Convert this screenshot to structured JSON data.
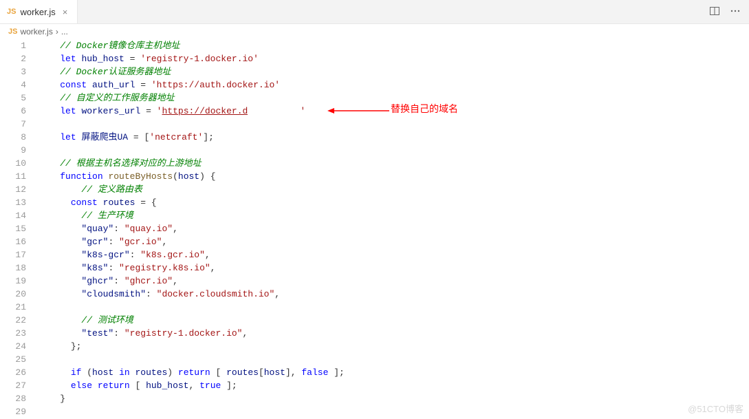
{
  "tab": {
    "icon": "JS",
    "name": "worker.js"
  },
  "breadcrumb": {
    "icon": "JS",
    "file": "worker.js",
    "sep": "›",
    "rest": "..."
  },
  "annotation": "替换自己的域名",
  "watermark": "@51CTO博客",
  "code": {
    "l1": {
      "comment": "// Docker镜像仓库主机地址"
    },
    "l2": {
      "kw": "let",
      "name": "hub_host",
      "eq": " = ",
      "str": "'registry-1.docker.io'"
    },
    "l3": {
      "comment": "// Docker认证服务器地址"
    },
    "l4": {
      "kw": "const",
      "name": "auth_url",
      "eq": " = ",
      "str": "'https://auth.docker.io'"
    },
    "l5": {
      "comment": "// 自定义的工作服务器地址"
    },
    "l6": {
      "kw": "let",
      "name": "workers_url",
      "eq": " = ",
      "q1": "'",
      "url": "https://docker.d",
      "q2": "'"
    },
    "l8": {
      "kw": "let",
      "name": "屏蔽爬虫UA",
      "eq": " = [",
      "str": "'netcraft'",
      "end": "];"
    },
    "l10": {
      "comment": "// 根据主机名选择对应的上游地址"
    },
    "l11": {
      "kw": "function",
      "fn": "routeByHosts",
      "args": "host"
    },
    "l12": {
      "comment": "// 定义路由表"
    },
    "l13": {
      "kw": "const",
      "name": "routes",
      "eq": " = {"
    },
    "l14": {
      "comment": "// 生产环境"
    },
    "l15": {
      "k": "\"quay\"",
      "v": "\"quay.io\""
    },
    "l16": {
      "k": "\"gcr\"",
      "v": "\"gcr.io\""
    },
    "l17": {
      "k": "\"k8s-gcr\"",
      "v": "\"k8s.gcr.io\""
    },
    "l18": {
      "k": "\"k8s\"",
      "v": "\"registry.k8s.io\""
    },
    "l19": {
      "k": "\"ghcr\"",
      "v": "\"ghcr.io\""
    },
    "l20": {
      "k": "\"cloudsmith\"",
      "v": "\"docker.cloudsmith.io\""
    },
    "l22": {
      "comment": "// 测试环境"
    },
    "l23": {
      "k": "\"test\"",
      "v": "\"registry-1.docker.io\""
    },
    "l24": {
      "t": "};"
    },
    "l26": {
      "kw1": "if",
      "cond_a": "host",
      "cond_in": "in",
      "cond_b": "routes",
      "kw2": "return",
      "a1": "routes",
      "a2": "host",
      "kw3": "false"
    },
    "l27": {
      "kw1": "else",
      "kw2": "return",
      "a1": "hub_host",
      "kw3": "true"
    },
    "l28": {
      "t": "}"
    }
  }
}
